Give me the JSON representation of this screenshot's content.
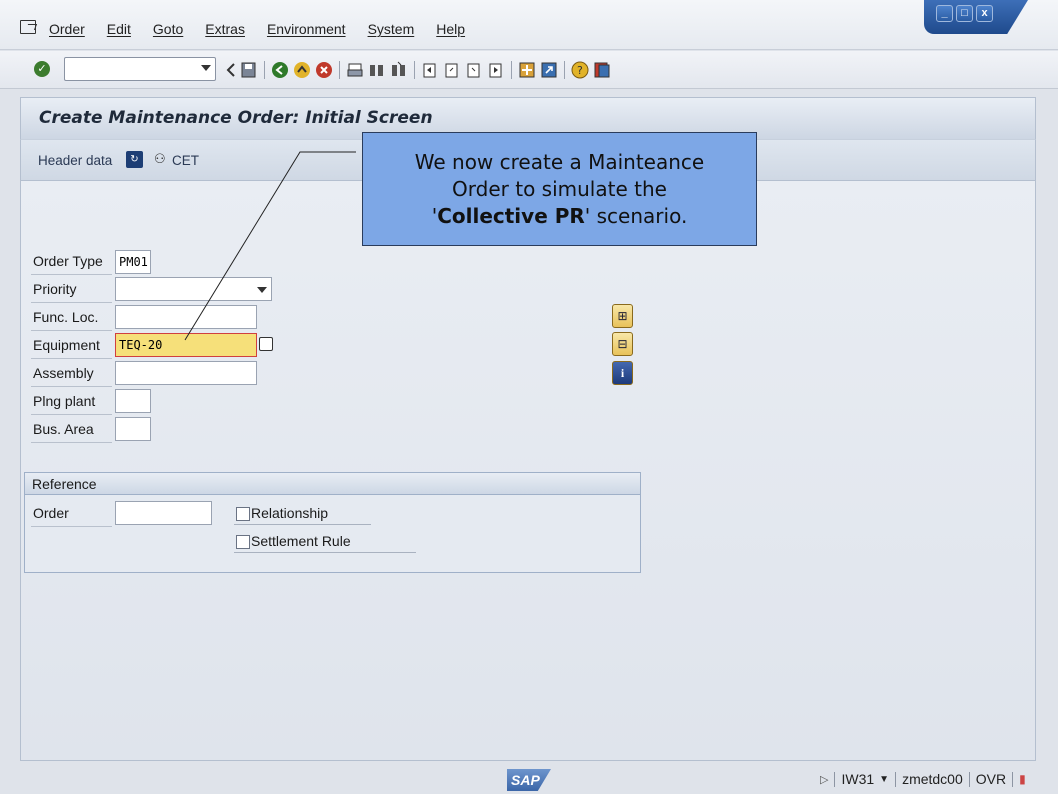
{
  "menu": {
    "items": [
      "Order",
      "Edit",
      "Goto",
      "Extras",
      "Environment",
      "System",
      "Help"
    ]
  },
  "window": {
    "minimize": "_",
    "maximize": "□",
    "close": "x"
  },
  "toolbar": {
    "command_value": "",
    "icons": [
      "back-icon",
      "save-icon",
      "green-back-icon",
      "exit-icon",
      "cancel-icon",
      "print-icon",
      "find-icon",
      "find-next-icon",
      "first-page-icon",
      "prev-page-icon",
      "next-page-icon",
      "last-page-icon",
      "new-session-icon",
      "shortcut-icon",
      "help-icon",
      "layout-icon"
    ]
  },
  "title": "Create Maintenance Order: Initial Screen",
  "appbar": {
    "header_data": "Header data",
    "cet": "CET"
  },
  "form": {
    "order_type_label": "Order Type",
    "order_type_value": "PM01",
    "priority_label": "Priority",
    "priority_value": "",
    "func_loc_label": "Func. Loc.",
    "func_loc_value": "",
    "equipment_label": "Equipment",
    "equipment_value": "TEQ-20",
    "assembly_label": "Assembly",
    "assembly_value": "",
    "plng_plant_label": "Plng plant",
    "plng_plant_value": "",
    "bus_area_label": "Bus. Area",
    "bus_area_value": ""
  },
  "reference": {
    "title": "Reference",
    "order_label": "Order",
    "order_value": "",
    "relationship_label": "Relationship",
    "settlement_label": "Settlement Rule"
  },
  "callout": {
    "line1": "We now create a Mainteance",
    "line2": "Order to simulate the",
    "quote_open": "'",
    "bold": "Collective PR",
    "rest": "' scenario."
  },
  "status": {
    "transaction": "IW31",
    "server": "zmetdc00",
    "mode": "OVR"
  }
}
